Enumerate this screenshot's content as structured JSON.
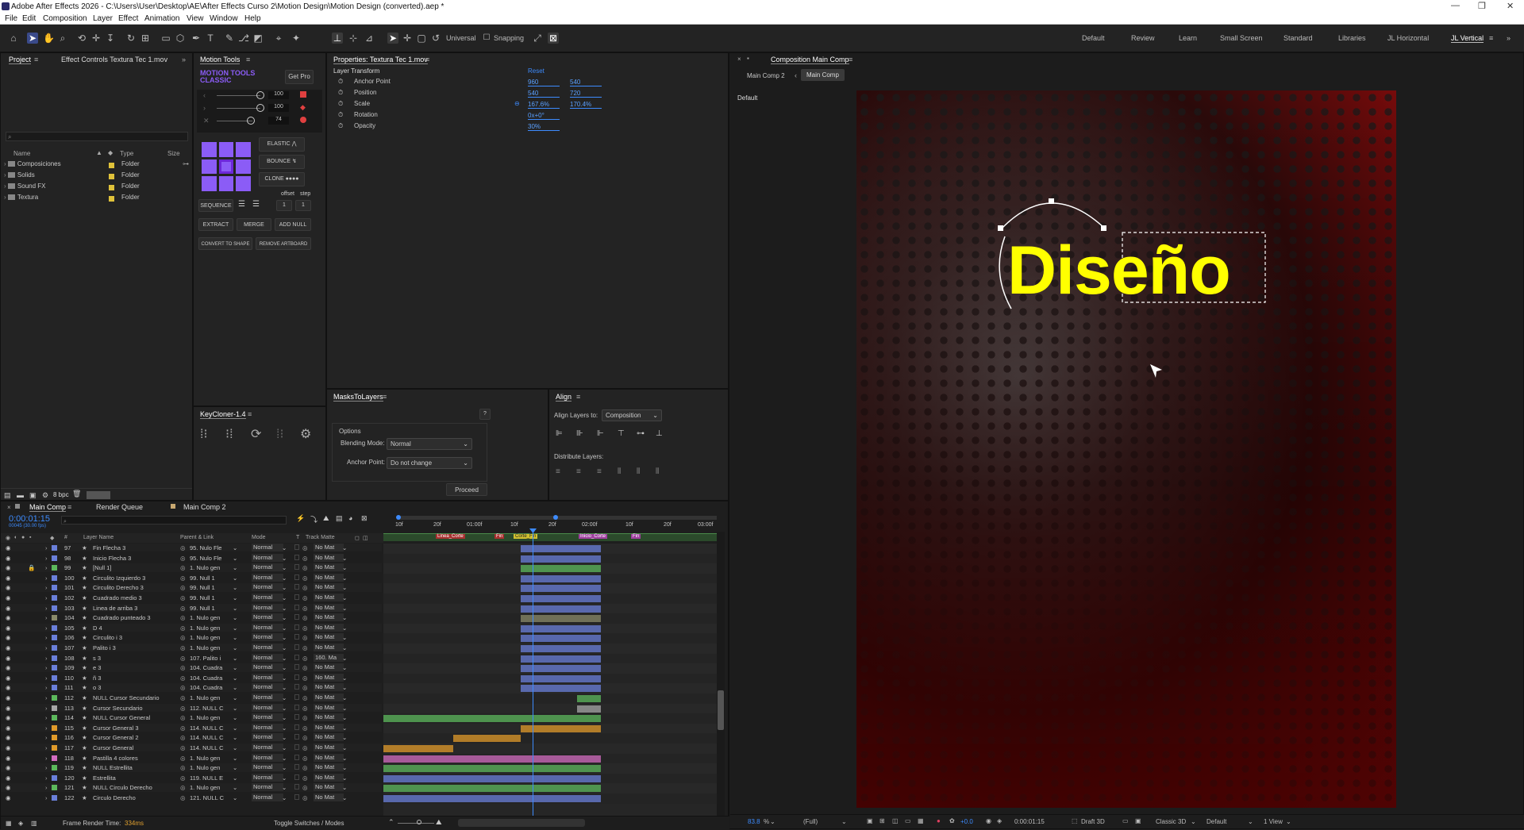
{
  "titlebar": {
    "title": "Adobe After Effects 2026 - C:\\Users\\User\\Desktop\\AE\\After Effects Curso 2\\Motion Design\\Motion Design (converted).aep *",
    "min": "—",
    "max": "❐",
    "close": "✕"
  },
  "menu": [
    "File",
    "Edit",
    "Composition",
    "Layer",
    "Effect",
    "Animation",
    "View",
    "Window",
    "Help"
  ],
  "toolbar": {
    "universal": "Universal",
    "snapping": "Snapping"
  },
  "workspaces": [
    "Default",
    "Review",
    "Learn",
    "Small Screen",
    "Standard",
    "Libraries",
    "JL Horizontal",
    "JL Vertical"
  ],
  "project": {
    "tab": "Project",
    "effect_tab": "Effect Controls Textura Tec 1.mov",
    "search_placeholder": "",
    "col_name": "Name",
    "col_type": "Type",
    "col_size": "Size",
    "items": [
      {
        "name": "Composiciones",
        "type": "Folder"
      },
      {
        "name": "Solids",
        "type": "Folder"
      },
      {
        "name": "Sound FX",
        "type": "Folder"
      },
      {
        "name": "Textura",
        "type": "Folder"
      }
    ],
    "bpc": "8 bpc"
  },
  "motion": {
    "tab": "Motion Tools",
    "logo1": "MOTION TOOLS",
    "logo2": "CLASSIC",
    "getpro": "Get Pro",
    "v1": "100",
    "v2": "100",
    "v3": "74",
    "elastic": "ELASTIC",
    "bounce": "BOUNCE",
    "clone": "CLONE",
    "offset": "offset",
    "step": "step",
    "sequence": "SEQUENCE",
    "o1": "1",
    "o2": "1",
    "extract": "EXTRACT",
    "merge": "MERGE",
    "addnull": "ADD NULL",
    "convert": "CONVERT TO SHAPE",
    "remove": "REMOVE ARTBOARD"
  },
  "keycloner": {
    "tab": "KeyCloner-1.4"
  },
  "properties": {
    "tab": "Properties: Textura Tec 1.mov",
    "section": "Layer Transform",
    "reset": "Reset",
    "props": [
      {
        "name": "Anchor Point",
        "v1": "960",
        "v2": "540"
      },
      {
        "name": "Position",
        "v1": "540",
        "v2": "720"
      },
      {
        "name": "Scale",
        "v1": "167.6%",
        "v2": "170.4%"
      },
      {
        "name": "Rotation",
        "v1": "0x+0°",
        "v2": ""
      },
      {
        "name": "Opacity",
        "v1": "30%",
        "v2": ""
      }
    ]
  },
  "masks": {
    "tab": "MasksToLayers",
    "help": "?",
    "options": "Options",
    "blend_label": "Blending Mode:",
    "blend_val": "Normal",
    "anchor_label": "Anchor Point:",
    "anchor_val": "Do not change",
    "proceed": "Proceed"
  },
  "align": {
    "tab": "Align",
    "align_to": "Align Layers to:",
    "align_val": "Composition",
    "distribute": "Distribute Layers:"
  },
  "comp": {
    "tab": "Composition Main Comp",
    "crumb1": "Main Comp 2",
    "crumb2": "Main Comp",
    "view": "Default",
    "text": "Diseño",
    "zoom": "83.8",
    "zoompct": "%",
    "res": "(Full)",
    "exposure": "+0.0",
    "time": "0:00:01:15",
    "draft": "Draft 3D",
    "renderer": "Classic 3D",
    "viewmode": "Default",
    "views": "1 View"
  },
  "timeline": {
    "tab1": "Main Comp",
    "tab2": "Render Queue",
    "tab3": "Main Comp 2",
    "time": "0:00:01:15",
    "frames": "00045 (30.00 fps)",
    "col_name": "Layer Name",
    "col_parent": "Parent & Link",
    "col_mode": "Mode",
    "col_t": "T",
    "col_matte": "Track Matte",
    "ruler": [
      "10f",
      "20f",
      "01:00f",
      "10f",
      "20f",
      "02:00f",
      "10f",
      "20f",
      "03:00f"
    ],
    "markers": [
      "Linea_Corte",
      "Fin",
      "Corte_Fin",
      "Inicio_Corte",
      "Fin"
    ],
    "frame_render": "Frame Render Time:",
    "frame_ms": "334ms",
    "toggle": "Toggle Switches / Modes",
    "layers": [
      {
        "n": "97",
        "name": "Fin Flecha 3",
        "parent": "95. Nulo Fle",
        "mode": "Normal",
        "matte": "No Mat",
        "color": "#6a7fd9"
      },
      {
        "n": "98",
        "name": "Inicio Flecha 3",
        "parent": "95. Nulo Fle",
        "mode": "Normal",
        "matte": "No Mat",
        "color": "#6a7fd9"
      },
      {
        "n": "99",
        "name": "[Null 1]",
        "parent": "1. Nulo gen",
        "mode": "Normal",
        "matte": "No Mat",
        "color": "#5cb85c"
      },
      {
        "n": "100",
        "name": "Circulito Izquierdo 3",
        "parent": "99. Null 1",
        "mode": "Normal",
        "matte": "No Mat",
        "color": "#6a7fd9"
      },
      {
        "n": "101",
        "name": "Circulito Derecho 3",
        "parent": "99. Null 1",
        "mode": "Normal",
        "matte": "No Mat",
        "color": "#6a7fd9"
      },
      {
        "n": "102",
        "name": "Cuadrado medio 3",
        "parent": "99. Null 1",
        "mode": "Normal",
        "matte": "No Mat",
        "color": "#6a7fd9"
      },
      {
        "n": "103",
        "name": "Linea de arriba 3",
        "parent": "99. Null 1",
        "mode": "Normal",
        "matte": "No Mat",
        "color": "#6a7fd9"
      },
      {
        "n": "104",
        "name": "Cuadrado punteado 3",
        "parent": "1. Nulo gen",
        "mode": "Normal",
        "matte": "No Mat",
        "color": "#8a8a6a"
      },
      {
        "n": "105",
        "name": "D 4",
        "parent": "1. Nulo gen",
        "mode": "Normal",
        "matte": "No Mat",
        "color": "#6a7fd9"
      },
      {
        "n": "106",
        "name": "Circulito i 3",
        "parent": "1. Nulo gen",
        "mode": "Normal",
        "matte": "No Mat",
        "color": "#6a7fd9"
      },
      {
        "n": "107",
        "name": "Palito i 3",
        "parent": "1. Nulo gen",
        "mode": "Normal",
        "matte": "No Mat",
        "color": "#6a7fd9"
      },
      {
        "n": "108",
        "name": "s 3",
        "parent": "107. Palito i",
        "mode": "Normal",
        "matte": "160. Ma",
        "color": "#6a7fd9"
      },
      {
        "n": "109",
        "name": "e 3",
        "parent": "104. Cuadra",
        "mode": "Normal",
        "matte": "No Mat",
        "color": "#6a7fd9"
      },
      {
        "n": "110",
        "name": "ñ 3",
        "parent": "104. Cuadra",
        "mode": "Normal",
        "matte": "No Mat",
        "color": "#6a7fd9"
      },
      {
        "n": "111",
        "name": "o 3",
        "parent": "104. Cuadra",
        "mode": "Normal",
        "matte": "No Mat",
        "color": "#6a7fd9"
      },
      {
        "n": "112",
        "name": "NULL Cursor Secundario",
        "parent": "1. Nulo gen",
        "mode": "Normal",
        "matte": "No Mat",
        "color": "#5cb85c"
      },
      {
        "n": "113",
        "name": "Cursor Secundario",
        "parent": "112. NULL C",
        "mode": "Normal",
        "matte": "No Mat",
        "color": "#a6a6a6"
      },
      {
        "n": "114",
        "name": "NULL Cursor General",
        "parent": "1. Nulo gen",
        "mode": "Normal",
        "matte": "No Mat",
        "color": "#5cb85c"
      },
      {
        "n": "115",
        "name": "Cursor General 3",
        "parent": "114. NULL C",
        "mode": "Normal",
        "matte": "No Mat",
        "color": "#e09a2a"
      },
      {
        "n": "116",
        "name": "Cursor General 2",
        "parent": "114. NULL C",
        "mode": "Normal",
        "matte": "No Mat",
        "color": "#e09a2a"
      },
      {
        "n": "117",
        "name": "Cursor General",
        "parent": "114. NULL C",
        "mode": "Normal",
        "matte": "No Mat",
        "color": "#e09a2a"
      },
      {
        "n": "118",
        "name": "Pastilla 4 colores",
        "parent": "1. Nulo gen",
        "mode": "Normal",
        "matte": "No Mat",
        "color": "#d36cc0"
      },
      {
        "n": "119",
        "name": "NULL Estrellita",
        "parent": "1. Nulo gen",
        "mode": "Normal",
        "matte": "No Mat",
        "color": "#5cb85c"
      },
      {
        "n": "120",
        "name": "Estrellita",
        "parent": "119. NULL E",
        "mode": "Normal",
        "matte": "No Mat",
        "color": "#6a7fd9"
      },
      {
        "n": "121",
        "name": "NULL Circulo Derecho",
        "parent": "1. Nulo gen",
        "mode": "Normal",
        "matte": "No Mat",
        "color": "#5cb85c"
      },
      {
        "n": "122",
        "name": "Circulo Derecho",
        "parent": "121. NULL C",
        "mode": "Normal",
        "matte": "No Mat",
        "color": "#6a7fd9"
      }
    ]
  }
}
